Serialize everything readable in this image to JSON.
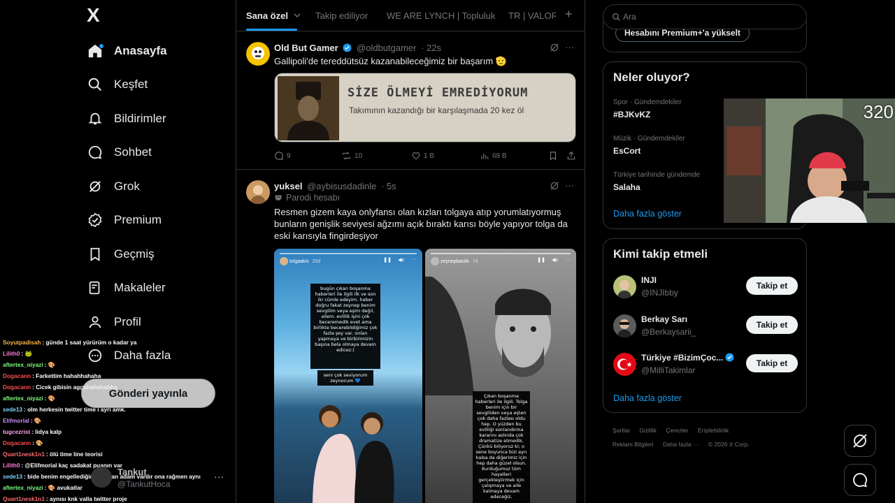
{
  "nav": {
    "logo": "X",
    "items": [
      {
        "label": "Anasayfa",
        "icon": "home-icon"
      },
      {
        "label": "Keşfet",
        "icon": "search-icon"
      },
      {
        "label": "Bildirimler",
        "icon": "bell-icon"
      },
      {
        "label": "Sohbet",
        "icon": "chat-icon"
      },
      {
        "label": "Grok",
        "icon": "grok-icon"
      },
      {
        "label": "Premium",
        "icon": "premium-icon"
      },
      {
        "label": "Geçmiş",
        "icon": "bookmark-icon"
      },
      {
        "label": "Makaleler",
        "icon": "article-icon"
      },
      {
        "label": "Profil",
        "icon": "profile-icon"
      },
      {
        "label": "Daha fazla",
        "icon": "more-icon"
      }
    ],
    "post_button": "Gönderi yayınla",
    "account": {
      "name": "Tankut",
      "handle": "@TankutHoca",
      "more": "···"
    }
  },
  "tabs": [
    {
      "label": "Sana özel"
    },
    {
      "label": "Takip ediliyor"
    },
    {
      "label": "WE ARE LYNCH | Topluluk"
    },
    {
      "label": "TR | VALORA"
    }
  ],
  "tab_add": "+",
  "posts": [
    {
      "name": "Old But Gamer",
      "handle": "@oldbutgamer",
      "time": "· 22s",
      "text": "Gallipoli'de tereddütsüz kazanabileceğimiz bir başarım 🫡",
      "banner_line1": "SİZE ÖLMEYİ EMREDİYORUM",
      "banner_line2": "Takımının kazandığı bir karşılaşmada 20 kez öl",
      "replies": "9",
      "reposts": "10",
      "likes": "1 B",
      "views": "68 B"
    },
    {
      "name": "yuksel",
      "handle": "@aybisusdadinle",
      "time": "· 5s",
      "label": "Parodi hesabı",
      "text": "Resmen gizem kaya onlyfansı olan kızları tolgaya atıp yorumlatıyormuş bunların genişlik seviyesi ağzımı açık bıraktı karısı böyle yapıyor tolga da eski karısıyla fingirdeşiyor",
      "story1_user": "tolgaakis",
      "story1_time": "25d",
      "story1_text": "bugün çıkan boşanma haberleri ile ilgili ilk ve son iki cümle edeyim. haber doğru fakat zeynep benim sevgilim veya eşim değil, ailem. evlilik işini çok beceremedik evet ama birlikte becerebildiğimiz çok fazla şey var. onları yapmaya ve birbirimizin başına bela olmaya devam edicez:)",
      "story1_caption": "seni çok seviyorum zeynocum 💙",
      "story2_user": "zeynepbastik",
      "story2_time": "7d",
      "story2_text": "Çıkan boşanma haberleri ile ilgili. Tolga benim için bir sevgiliden veya eşten çok daha fazlası oldu hep. O yüzden bu evliliği sonlandırma kararını aslında çok dramatize etmedik. Çünkü biliyoruz ki; o sene boyunca bizi ayrı kalsa da diğerimiz için hep daha güzel olsun. Kurduğumuz tüm hayalleri gerçekleştirmek için çalışmaya ve aile kalmaya devam edeceğiz."
    }
  ],
  "search": {
    "placeholder": "Ara"
  },
  "premium_button": "Hesabını Premium+'a yükselt",
  "trends": {
    "title": "Neler oluyor?",
    "items": [
      {
        "category": "Spor · Gündemdekiler",
        "topic": "#BJKvKZ"
      },
      {
        "category": "Müzik · Gündemdekiler",
        "topic": "EsCort"
      },
      {
        "category": "Türkiye tarihinde gündemde",
        "topic": "Salaha"
      }
    ],
    "more": "Daha fazla göster"
  },
  "who_to_follow": {
    "title": "Kimi takip etmeli",
    "items": [
      {
        "name": "INJI",
        "handle": "@INJIbby",
        "button": "Takip et"
      },
      {
        "name": "Berkay Sarı",
        "handle": "@Berkaysarii_",
        "button": "Takip et"
      },
      {
        "name": "Türkiye #BizimÇoc...",
        "handle": "@MilliTakimlar",
        "button": "Takip et"
      }
    ],
    "more": "Daha fazla göster"
  },
  "footer": {
    "row1": [
      "Şartlar",
      "Gizlilik",
      "Çerezler",
      "Erişilebilirlik"
    ],
    "row2": [
      "Reklam Bilgileri",
      "Daha fazla ···",
      "© 2026 X Corp."
    ]
  },
  "webcam": {
    "viewer_count": "320"
  },
  "chat": [
    {
      "user": "Soyutpadisah",
      "color": "#ffb347",
      "msg": ": günde 1 saat yürürüm o kadar ya"
    },
    {
      "user": "Lilith0",
      "color": "#ff7fd5",
      "msg": ": 🐸"
    },
    {
      "user": "aftertex_niyazi",
      "color": "#7fff7f",
      "msg": ": 🎨"
    },
    {
      "user": "Dogacann",
      "color": "#ff4d4d",
      "msg": ": Farkettim hahahhahaha"
    },
    {
      "user": "Dogacann",
      "color": "#ff4d4d",
      "msg": ": Cicek gibisin aggshahahahha"
    },
    {
      "user": "aftertex_niyazi",
      "color": "#7fff7f",
      "msg": ": 🎨"
    },
    {
      "user": "sede13",
      "color": "#7fd4ff",
      "msg": ": olm herkesin twitter time i ayrı amk."
    },
    {
      "user": "Elifmorial",
      "color": "#d08cff",
      "msg": ": 🎨"
    },
    {
      "user": "tugcezrist",
      "color": "#ffa3f0",
      "msg": ": lidya kalp"
    },
    {
      "user": "Dogacann",
      "color": "#ff4d4d",
      "msg": ": 🎨"
    },
    {
      "user": "Quart1nesk1n1",
      "color": "#ff6b6b",
      "msg": ": ölü time line teorisi"
    },
    {
      "user": "Lilith0",
      "color": "#ff7fd5",
      "msg": ": @Elifmorial kaç sadakat puanın var"
    },
    {
      "user": "sede13",
      "color": "#7fd4ff",
      "msg": ": bide benim engellediğim 2k falan adam vardır ona rağmen aynı"
    },
    {
      "user": "aftertex_niyazi",
      "color": "#7fff7f",
      "msg": ": 🎨 avukatlar"
    },
    {
      "user": "Quart1nesk1n1",
      "color": "#ff6b6b",
      "msg": ": aynısı knk valla twitter proje"
    }
  ],
  "colors": {
    "accent": "#1d9bf0",
    "background": "#000000",
    "border": "#2f3336",
    "muted": "#71767b"
  }
}
